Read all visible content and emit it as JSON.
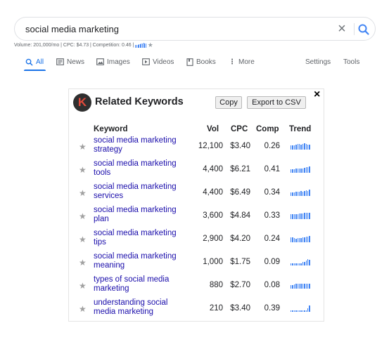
{
  "search": {
    "query": "social media marketing",
    "stats": "Volume: 201,000/mo | CPC: $4.73 | Competition: 0.46 |",
    "stats_trend": [
      0.6,
      0.5,
      0.6,
      0.7,
      0.7,
      0.8,
      0.9,
      1.0,
      0.8,
      0.8
    ]
  },
  "tabs": [
    {
      "label": "All",
      "icon": "search-icon"
    },
    {
      "label": "News",
      "icon": "news-icon"
    },
    {
      "label": "Images",
      "icon": "image-icon"
    },
    {
      "label": "Videos",
      "icon": "video-icon"
    },
    {
      "label": "Books",
      "icon": "book-icon"
    },
    {
      "label": "More",
      "icon": "more-vertical-icon"
    },
    {
      "label": "Settings"
    },
    {
      "label": "Tools"
    }
  ],
  "panel": {
    "logo_letter": "K",
    "title": "Related Keywords",
    "copy_label": "Copy",
    "export_label": "Export to CSV",
    "close_label": "×",
    "headers": {
      "keyword": "Keyword",
      "vol": "Vol",
      "cpc": "CPC",
      "comp": "Comp",
      "trend": "Trend"
    },
    "rows": [
      {
        "keyword": "social media marketing strategy",
        "vol": "12,100",
        "cpc": "$3.40",
        "comp": "0.26",
        "trend": [
          0.7,
          0.7,
          0.7,
          0.8,
          0.9,
          0.9,
          0.8,
          0.9,
          1.0,
          0.9,
          0.8,
          0.8
        ]
      },
      {
        "keyword": "social media marketing tools",
        "vol": "4,400",
        "cpc": "$6.21",
        "comp": "0.41",
        "trend": [
          0.6,
          0.6,
          0.6,
          0.7,
          0.7,
          0.7,
          0.7,
          0.7,
          0.8,
          0.9,
          0.9,
          1.0
        ]
      },
      {
        "keyword": "social media marketing services",
        "vol": "4,400",
        "cpc": "$6.49",
        "comp": "0.34",
        "trend": [
          0.5,
          0.6,
          0.5,
          0.7,
          0.7,
          0.7,
          0.8,
          0.7,
          0.8,
          0.9,
          0.8,
          1.0
        ]
      },
      {
        "keyword": "social media marketing plan",
        "vol": "3,600",
        "cpc": "$4.84",
        "comp": "0.33",
        "trend": [
          0.8,
          0.8,
          0.8,
          0.8,
          0.8,
          0.9,
          0.9,
          0.9,
          1.0,
          1.0,
          1.0,
          1.0
        ]
      },
      {
        "keyword": "social media marketing tips",
        "vol": "2,900",
        "cpc": "$4.20",
        "comp": "0.24",
        "trend": [
          0.8,
          0.8,
          0.7,
          0.6,
          0.7,
          0.7,
          0.7,
          0.8,
          0.8,
          0.9,
          0.9,
          1.0
        ]
      },
      {
        "keyword": "social media marketing meaning",
        "vol": "1,000",
        "cpc": "$1.75",
        "comp": "0.09",
        "trend": [
          0.3,
          0.3,
          0.3,
          0.3,
          0.3,
          0.3,
          0.3,
          0.5,
          0.5,
          0.8,
          1.0,
          0.9
        ]
      },
      {
        "keyword": "types of social media marketing",
        "vol": "880",
        "cpc": "$2.70",
        "comp": "0.08",
        "trend": [
          0.6,
          0.6,
          0.7,
          0.8,
          0.8,
          0.8,
          0.8,
          0.8,
          0.8,
          0.8,
          0.8,
          0.8
        ]
      },
      {
        "keyword": "understanding social media marketing",
        "vol": "210",
        "cpc": "$3.40",
        "comp": "0.39",
        "trend": [
          0.2,
          0.2,
          0.2,
          0.2,
          0.2,
          0.2,
          0.2,
          0.2,
          0.2,
          0.2,
          0.5,
          1.0
        ]
      }
    ]
  },
  "colors": {
    "link": "#1a0dab",
    "accent": "#1a73e8",
    "trend": "#4285f4"
  }
}
